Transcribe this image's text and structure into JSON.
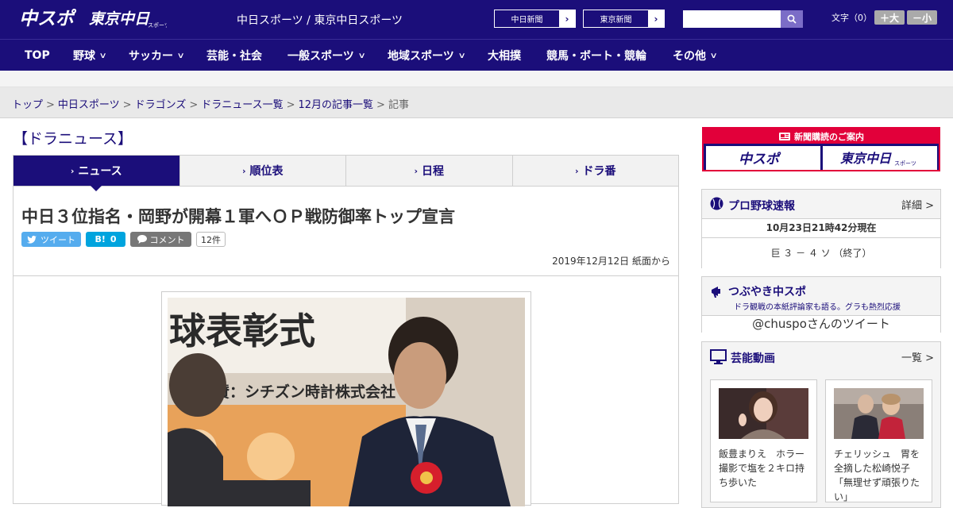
{
  "header": {
    "logo_main": "中スポ",
    "logo_tokyo": "東京中日",
    "logo_tokyo_small": "スポーツ",
    "site_title": "中日スポーツ / 東京中日スポーツ",
    "paper_links": [
      {
        "label": "中日新聞",
        "arrow": "›"
      },
      {
        "label": "東京新聞",
        "arrow": "›"
      }
    ],
    "search": {
      "placeholder": "",
      "value": ""
    },
    "font_size": {
      "label": "文字（0）",
      "larger": "＋大",
      "smaller": "－小"
    },
    "brand_color": "#1b0e7a"
  },
  "nav": {
    "items": [
      {
        "label": "TOP",
        "dropdown": false
      },
      {
        "label": "野球",
        "dropdown": true
      },
      {
        "label": "サッカー",
        "dropdown": true
      },
      {
        "label": "芸能・社会",
        "dropdown": false
      },
      {
        "label": "一般スポーツ",
        "dropdown": true
      },
      {
        "label": "地域スポーツ",
        "dropdown": true
      },
      {
        "label": "大相撲",
        "dropdown": false
      },
      {
        "label": "競馬・ボート・競輪",
        "dropdown": false
      },
      {
        "label": "その他",
        "dropdown": true
      }
    ],
    "chevron": "∨"
  },
  "breadcrumb": {
    "items": [
      "トップ",
      "中日スポーツ",
      "ドラゴンズ",
      "ドラニュース一覧",
      "12月の記事一覧"
    ],
    "current": "記事",
    "separator": ">"
  },
  "main": {
    "section_title": "【ドラニュース】",
    "tabs": [
      {
        "label": "ニュース",
        "active": true
      },
      {
        "label": "順位表",
        "active": false
      },
      {
        "label": "日程",
        "active": false
      },
      {
        "label": "ドラ番",
        "active": false
      }
    ],
    "tab_arrow": "›",
    "article": {
      "headline": "中日３位指名・岡野が開幕１軍へＯＰ戦防御率トップ宣言",
      "share": {
        "tweet_label": "ツイート",
        "hatena_label": "B!",
        "hatena_count": "0",
        "comment_label": "コメント",
        "comment_count": "12件"
      },
      "dateline": "2019年12月12日 紙面から",
      "photo": {
        "banner_text": "球表彰式",
        "sponsor_text": "協賛：シチズン時計株式会社"
      }
    }
  },
  "sidebar": {
    "ad": {
      "title": "新聞購読のご案内",
      "logo_left": "中スポ",
      "logo_right": "東京中日",
      "logo_right_small": "スポーツ"
    },
    "baseball": {
      "title": "プロ野球速報",
      "more": "詳細 >",
      "updated": "10月23日21時42分現在",
      "score": "巨 ３ － ４ ソ （終了）"
    },
    "tweets": {
      "title": "つぶやき中スポ",
      "subtitle": "ドラ観戦の本紙評論家も語る。グラも熱烈応援",
      "link": "@chuspoさんのツイート"
    },
    "videos": {
      "title": "芸能動画",
      "more": "一覧 >",
      "items": [
        {
          "caption": "飯豊まりえ　ホラー撮影で塩を２キロ持ち歩いた"
        },
        {
          "caption": "チェリッシュ　胃を全摘した松崎悦子「無理せず頑張りたい」"
        }
      ]
    }
  }
}
